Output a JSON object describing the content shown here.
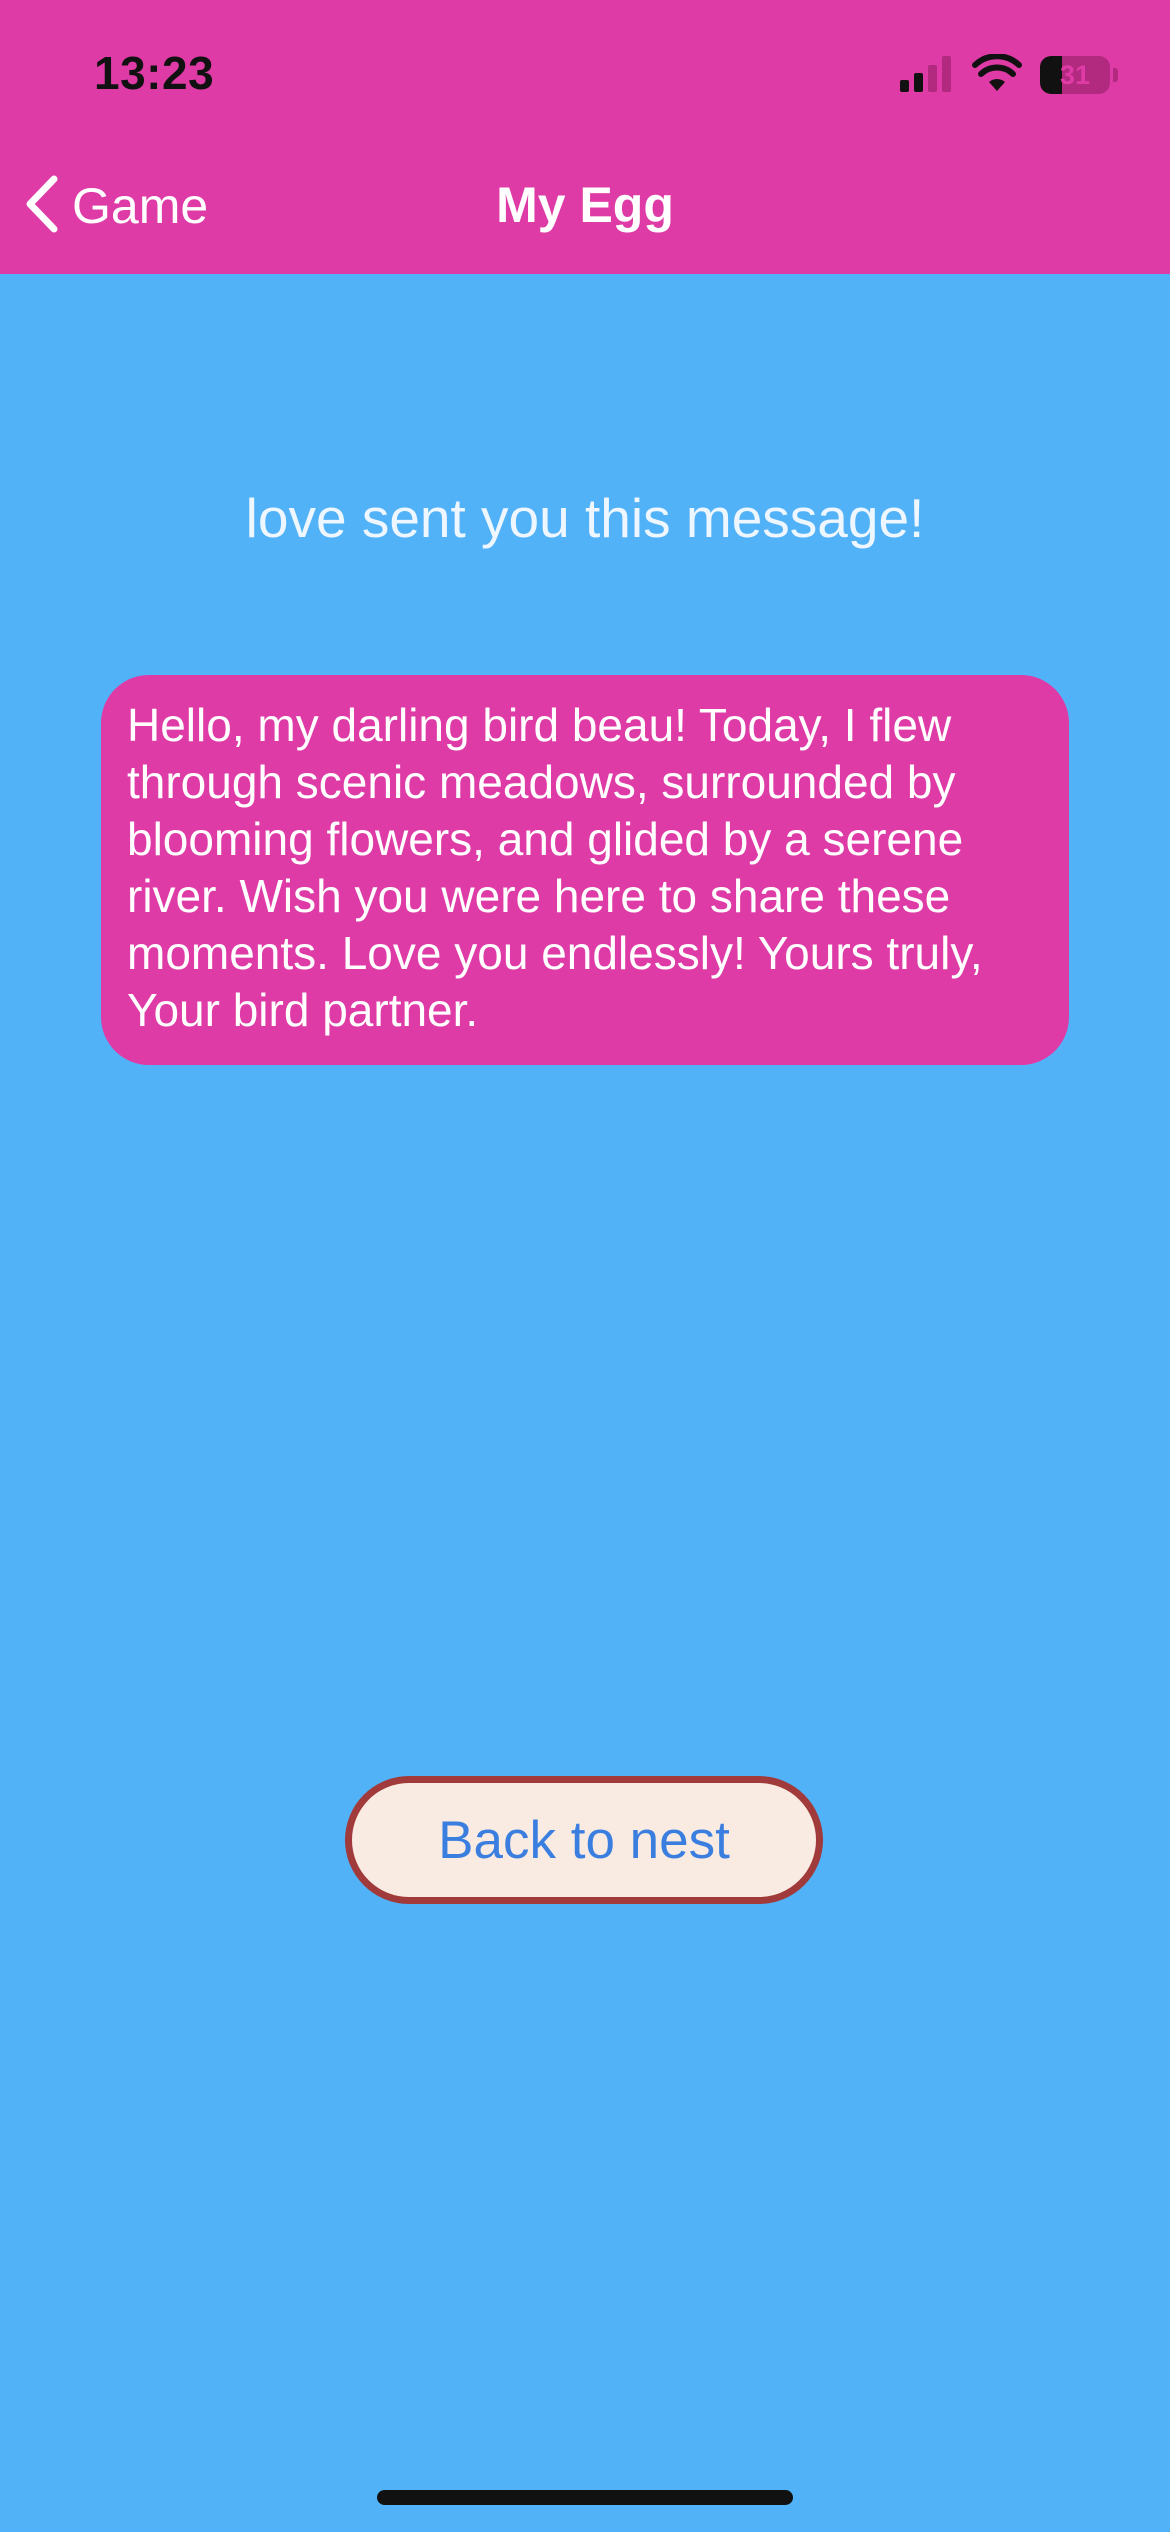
{
  "status_bar": {
    "time": "13:23",
    "battery": "31",
    "battery_level": 0.31,
    "icons": [
      "signal-icon",
      "wifi-icon",
      "battery-icon"
    ]
  },
  "nav": {
    "back_label": "Game",
    "title": "My Egg"
  },
  "message": {
    "intro": "love sent you this message!",
    "body": "Hello, my darling bird beau! Today, I flew through scenic meadows, surrounded by blooming flowers, and glided by a serene river. Wish you were here to share these moments. Love you endlessly! Yours truly, Your bird partner."
  },
  "actions": {
    "back_to_nest": "Back to nest"
  },
  "colors": {
    "header": "#df3ba6",
    "background": "#52b2f7",
    "bubble": "#df3ba6",
    "button_fill": "#f9eae2",
    "button_border": "#a13a3a",
    "button_text": "#3a7fe0"
  }
}
